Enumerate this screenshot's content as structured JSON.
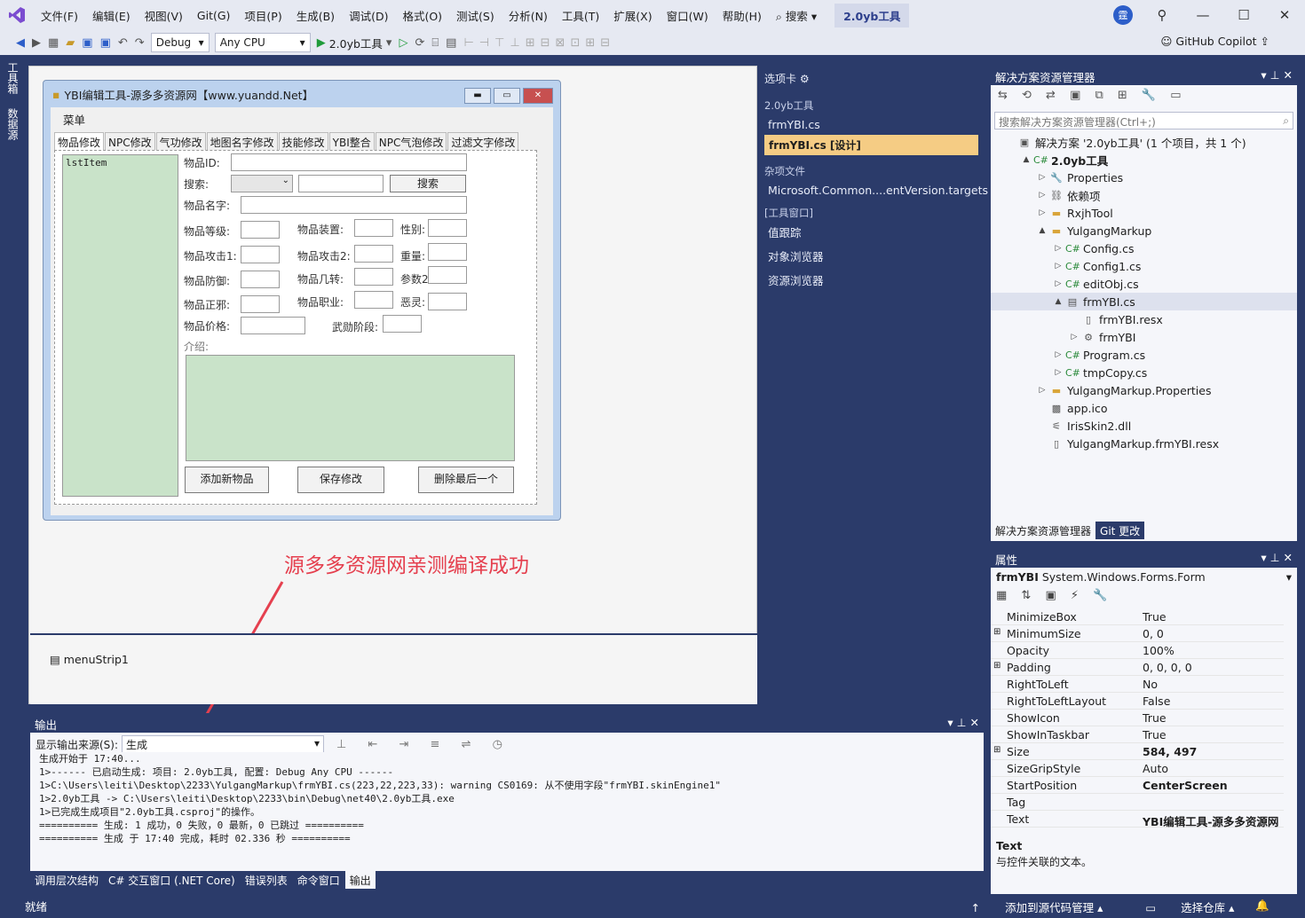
{
  "menubar": {
    "items": [
      "文件(F)",
      "编辑(E)",
      "视图(V)",
      "Git(G)",
      "项目(P)",
      "生成(B)",
      "调试(D)",
      "格式(O)",
      "测试(S)",
      "分析(N)",
      "工具(T)",
      "扩展(X)",
      "窗口(W)",
      "帮助(H)"
    ],
    "search_label": "搜索",
    "project_title": "2.0yb工具",
    "avatar": "霆"
  },
  "toolbar": {
    "config": "Debug",
    "platform": "Any CPU",
    "run_label": "2.0yb工具",
    "copilot_label": "GitHub Copilot"
  },
  "left_tabs": [
    "工具箱",
    "数据源"
  ],
  "form": {
    "title": "YBI编辑工具-源多多资源网【www.yuandd.Net】",
    "menu": "菜单",
    "tabs": [
      "物品修改",
      "NPC修改",
      "气功修改",
      "地图名字修改",
      "技能修改",
      "YBI整合",
      "NPC气泡修改",
      "过滤文字修改"
    ],
    "list_label": "lstItem",
    "labels": {
      "item_id": "物品ID:",
      "search": "搜索:",
      "name": "物品名字:",
      "level": "物品等级:",
      "equip": "物品装置:",
      "gender": "性别:",
      "attack1": "物品攻击1:",
      "attack2": "物品攻击2:",
      "weight": "重量:",
      "defense": "物品防御:",
      "several": "物品几转:",
      "param2": "参数2:",
      "good_evil": "物品正邪:",
      "job": "物品职业:",
      "evil": "恶灵:",
      "price": "物品价格:",
      "martial": "武勋阶段:",
      "intro": "介绍:"
    },
    "buttons": {
      "search": "搜索",
      "add": "添加新物品",
      "save": "保存修改",
      "delete": "删除最后一个"
    }
  },
  "annotation": "源多多资源网亲测编译成功",
  "tray_item": "menuStrip1",
  "toolbox": {
    "header": "选项卡",
    "section1": "2.0yb工具",
    "items1": [
      "frmYBI.cs"
    ],
    "selected": "frmYBI.cs [设计]",
    "section2": "杂项文件",
    "items2": [
      "Microsoft.Common....entVersion.targets"
    ],
    "section3": "[工具窗口]",
    "items3": [
      "值跟踪",
      "对象浏览器",
      "资源浏览器"
    ]
  },
  "solution": {
    "header": "解决方案资源管理器",
    "search_placeholder": "搜索解决方案资源管理器(Ctrl+;)",
    "tree": [
      {
        "label": "解决方案 '2.0yb工具' (1 个项目，共 1 个)",
        "icon": "solution-icon",
        "expand": ""
      },
      {
        "label": "2.0yb工具",
        "icon": "csproj-icon",
        "expand": "▲",
        "bold": true
      },
      {
        "label": "Properties",
        "icon": "wrench-icon",
        "expand": "▷"
      },
      {
        "label": "依赖项",
        "icon": "dependency-icon",
        "expand": "▷"
      },
      {
        "label": "RxjhTool",
        "icon": "folder-icon",
        "expand": "▷"
      },
      {
        "label": "YulgangMarkup",
        "icon": "folder-icon",
        "expand": "▲"
      },
      {
        "label": "Config.cs",
        "icon": "csharp-icon",
        "expand": "▷"
      },
      {
        "label": "Config1.cs",
        "icon": "csharp-icon",
        "expand": "▷"
      },
      {
        "label": "editObj.cs",
        "icon": "csharp-icon",
        "expand": "▷"
      },
      {
        "label": "frmYBI.cs",
        "icon": "form-icon",
        "expand": "▲"
      },
      {
        "label": "frmYBI.resx",
        "icon": "file-icon",
        "expand": ""
      },
      {
        "label": "frmYBI",
        "icon": "class-icon",
        "expand": "▷"
      },
      {
        "label": "Program.cs",
        "icon": "csharp-icon",
        "expand": "▷"
      },
      {
        "label": "tmpCopy.cs",
        "icon": "csharp-icon",
        "expand": "▷"
      },
      {
        "label": "YulgangMarkup.Properties",
        "icon": "folder-icon",
        "expand": "▷"
      },
      {
        "label": "app.ico",
        "icon": "ico-icon",
        "expand": ""
      },
      {
        "label": "IrisSkin2.dll",
        "icon": "dll-icon",
        "expand": ""
      },
      {
        "label": "YulgangMarkup.frmYBI.resx",
        "icon": "file-icon",
        "expand": ""
      }
    ],
    "tabs": [
      "解决方案资源管理器",
      "Git 更改"
    ]
  },
  "properties": {
    "header": "属性",
    "object_name": "frmYBI",
    "object_type": "System.Windows.Forms.Form",
    "rows": [
      {
        "name": "MinimizeBox",
        "value": "True",
        "exp": ""
      },
      {
        "name": "MinimumSize",
        "value": "0, 0",
        "exp": "⊞"
      },
      {
        "name": "Opacity",
        "value": "100%",
        "exp": ""
      },
      {
        "name": "Padding",
        "value": "0, 0, 0, 0",
        "exp": "⊞"
      },
      {
        "name": "RightToLeft",
        "value": "No",
        "exp": ""
      },
      {
        "name": "RightToLeftLayout",
        "value": "False",
        "exp": ""
      },
      {
        "name": "ShowIcon",
        "value": "True",
        "exp": ""
      },
      {
        "name": "ShowInTaskbar",
        "value": "True",
        "exp": ""
      },
      {
        "name": "Size",
        "value": "584, 497",
        "exp": "⊞",
        "bold": true
      },
      {
        "name": "SizeGripStyle",
        "value": "Auto",
        "exp": ""
      },
      {
        "name": "StartPosition",
        "value": "CenterScreen",
        "exp": "",
        "bold": true
      },
      {
        "name": "Tag",
        "value": "",
        "exp": ""
      },
      {
        "name": "Text",
        "value": "YBI编辑工具-源多多资源网【",
        "exp": "",
        "bold": true
      }
    ],
    "desc_title": "Text",
    "desc_text": "与控件关联的文本。"
  },
  "output": {
    "header": "输出",
    "source_label": "显示输出来源(S):",
    "source_value": "生成",
    "lines": [
      "生成开始于 17:40...",
      "1>------ 已启动生成: 项目: 2.0yb工具, 配置: Debug Any CPU ------",
      "1>C:\\Users\\leiti\\Desktop\\2233\\YulgangMarkup\\frmYBI.cs(223,22,223,33): warning CS0169: 从不使用字段\"frmYBI.skinEngine1\"",
      "1>2.0yb工具 -> C:\\Users\\leiti\\Desktop\\2233\\bin\\Debug\\net40\\2.0yb工具.exe",
      "1>已完成生成项目\"2.0yb工具.csproj\"的操作。",
      "========== 生成: 1 成功，0 失败，0 最新，0 已跳过 ==========",
      "========== 生成 于 17:40 完成，耗时 02.336 秒 =========="
    ]
  },
  "bottom_tabs": [
    "调用层次结构",
    "C# 交互窗口 (.NET Core)",
    "错误列表",
    "命令窗口",
    "输出"
  ],
  "status": {
    "left": "就绪",
    "add_source": "添加到源代码管理",
    "select_repo": "选择仓库"
  },
  "colors": {
    "accent": "#2b3b6a",
    "selected": "#f5cc84",
    "annotation": "#e5404f",
    "list_bg": "#c9e3c9"
  }
}
